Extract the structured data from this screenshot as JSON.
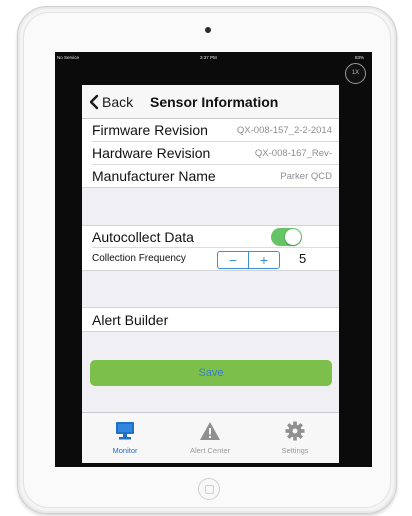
{
  "statusbar": {
    "carrier": "No Service",
    "time": "3:37 PM",
    "battery": "83%"
  },
  "zoom_badge": "1X",
  "nav": {
    "back_label": "Back",
    "title": "Sensor Information"
  },
  "info_rows": [
    {
      "label": "Firmware Revision",
      "value": "QX-008-157_2-2-2014"
    },
    {
      "label": "Hardware Revision",
      "value": "QX-008-167_Rev-"
    },
    {
      "label": "Manufacturer Name",
      "value": "Parker QCD"
    }
  ],
  "autocollect": {
    "label": "Autocollect Data",
    "enabled": true
  },
  "frequency": {
    "label": "Collection Frequency",
    "minus": "−",
    "plus": "+",
    "value": "5"
  },
  "alert_builder": {
    "label": "Alert Builder"
  },
  "save": {
    "label": "Save"
  },
  "tabs": [
    {
      "label": "Monitor",
      "icon": "monitor-icon",
      "active": true
    },
    {
      "label": "Alert Center",
      "icon": "warning-icon",
      "active": false
    },
    {
      "label": "Settings",
      "icon": "gear-icon",
      "active": false
    }
  ],
  "colors": {
    "accent": "#1f6fc4",
    "toggle_on": "#65c466",
    "save_bg": "#7cc04b",
    "stepper": "#3a8fd6"
  }
}
